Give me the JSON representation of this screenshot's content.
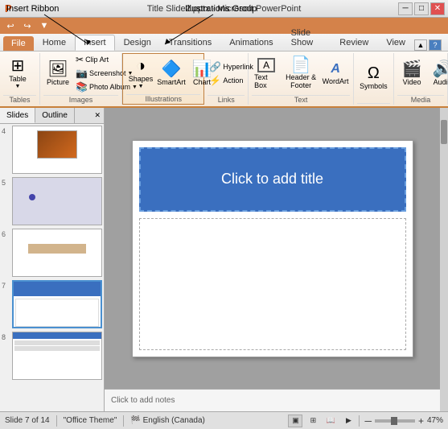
{
  "window": {
    "title": "Title Slide2.pptx - Microsoft PowerPoint",
    "min_btn": "─",
    "max_btn": "□",
    "close_btn": "✕"
  },
  "annotations": {
    "insert_ribbon": "Insert Ribbon",
    "illustrations_group": "Illustrations Group"
  },
  "qat": {
    "btns": [
      "◄",
      "▼",
      "↩",
      "↪",
      "▼"
    ]
  },
  "ribbon": {
    "tabs": [
      "File",
      "Home",
      "Insert",
      "Design",
      "Transitions",
      "Animations",
      "Slide Show",
      "Review",
      "View"
    ],
    "active_tab": "Insert",
    "groups": {
      "tables": {
        "label": "Tables",
        "table_btn": "Table"
      },
      "images": {
        "label": "Images",
        "picture_btn": "Picture",
        "clip_art_btn": "Clip Art",
        "screenshot_btn": "Screenshot",
        "photo_album_btn": "Photo Album"
      },
      "illustrations": {
        "label": "Illustrations",
        "shapes_btn": "Shapes",
        "smartart_btn": "SmartArt",
        "chart_btn": "Chart"
      },
      "links": {
        "label": "Links",
        "hyperlink_btn": "Hyperlink",
        "action_btn": "Action"
      },
      "text": {
        "label": "Text",
        "textbox_btn": "Text Box",
        "header_footer_btn": "Header & Footer",
        "wordart_btn": "WordArt"
      },
      "symbols": {
        "label": "",
        "symbols_btn": "Symbols"
      },
      "media": {
        "label": "Media",
        "video_btn": "Video",
        "audio_btn": "Audio"
      }
    }
  },
  "slide_panel": {
    "tabs": [
      "Slides",
      "Outline"
    ],
    "slides": [
      {
        "number": "4",
        "type": "image"
      },
      {
        "number": "5",
        "type": "dot"
      },
      {
        "number": "6",
        "type": "bar"
      },
      {
        "number": "7",
        "type": "title",
        "active": true
      },
      {
        "number": "8",
        "type": "header"
      }
    ]
  },
  "slide": {
    "title_placeholder": "Click to add title",
    "notes_placeholder": "Click to add notes"
  },
  "status_bar": {
    "slide_info": "Slide 7 of 14",
    "theme": "\"Office Theme\"",
    "language": "English (Canada)",
    "zoom": "47%",
    "zoom_minus": "─",
    "zoom_plus": "+"
  }
}
